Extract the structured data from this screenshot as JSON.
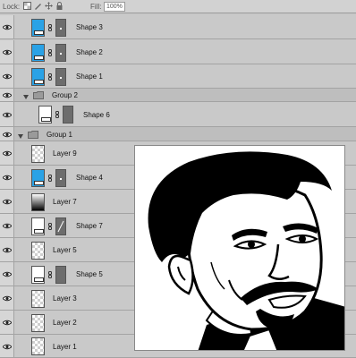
{
  "toolbar": {
    "lock_label": "Lock:",
    "fill_label": "Fill:",
    "fill_value": "100%",
    "lock_icons": [
      "lock-transparent-icon",
      "lock-paint-icon",
      "lock-move-icon",
      "lock-all-icon"
    ]
  },
  "layers": [
    {
      "name": "Shape 3",
      "type": "shape"
    },
    {
      "name": "Shape 2",
      "type": "shape"
    },
    {
      "name": "Shape 1",
      "type": "shape"
    },
    {
      "name": "Group 2",
      "type": "group"
    },
    {
      "name": "Shape 6",
      "type": "shape"
    },
    {
      "name": "Group 1",
      "type": "group"
    },
    {
      "name": "Layer 9",
      "type": "pixel"
    },
    {
      "name": "Shape 4",
      "type": "shape"
    },
    {
      "name": "Layer 7",
      "type": "pixel"
    },
    {
      "name": "Shape 7",
      "type": "shape"
    },
    {
      "name": "Layer 5",
      "type": "pixel"
    },
    {
      "name": "Shape 5",
      "type": "shape"
    },
    {
      "name": "Layer 3",
      "type": "pixel"
    },
    {
      "name": "Layer 2",
      "type": "pixel"
    },
    {
      "name": "Layer 1",
      "type": "pixel"
    }
  ],
  "colors": {
    "shape_fill_blue": "#2aa2e6",
    "panel_bg": "#c9c9c9",
    "mask_gray": "#6d6d6d"
  },
  "canvas_preview": {
    "icon": "meme-face-image"
  }
}
